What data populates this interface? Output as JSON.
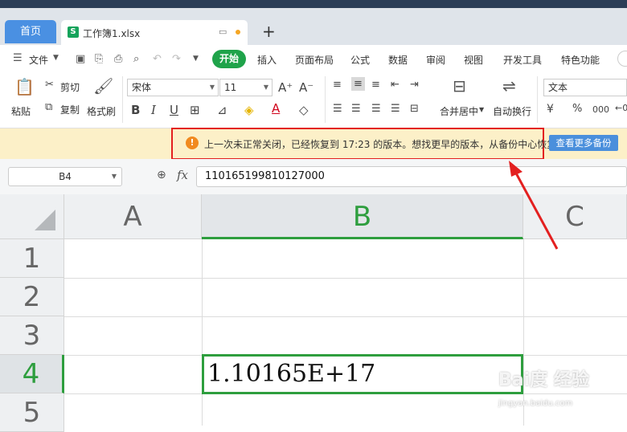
{
  "tabs": {
    "home": "首页",
    "file": "工作簿1.xlsx",
    "file_icon": "S"
  },
  "menu": {
    "file": "文件",
    "items": [
      "开始",
      "插入",
      "页面布局",
      "公式",
      "数据",
      "审阅",
      "视图",
      "开发工具",
      "特色功能"
    ]
  },
  "ribbon": {
    "paste": "粘贴",
    "cut": "剪切",
    "copy": "复制",
    "format_painter": "格式刷",
    "font_name": "宋体",
    "font_size": "11",
    "merge_center": "合并居中",
    "auto_wrap": "自动换行",
    "number_format": "文本",
    "bold": "B",
    "italic": "I",
    "underline": "U",
    "percent": "%",
    "thousands": "000"
  },
  "notice": {
    "text": "上一次未正常关闭，已经恢复到 17:23 的版本。想找更早的版本，从备份中心恢复",
    "button": "查看更多备份",
    "warn_glyph": "!"
  },
  "formula_bar": {
    "name_box": "B4",
    "fx": "fx",
    "value": "110165199810127000"
  },
  "grid": {
    "columns": [
      "A",
      "B",
      "C"
    ],
    "rows": [
      "1",
      "2",
      "3",
      "4",
      "5"
    ],
    "selected_cell": "B4",
    "B4_display": "1.10165E+17"
  },
  "watermark": {
    "main": "Bai度 经验",
    "sub": "jingyan.baidu.com"
  },
  "colors": {
    "accent_green": "#2e9e3e",
    "home_tab": "#4a90e2",
    "highlight_red": "#e32020"
  }
}
